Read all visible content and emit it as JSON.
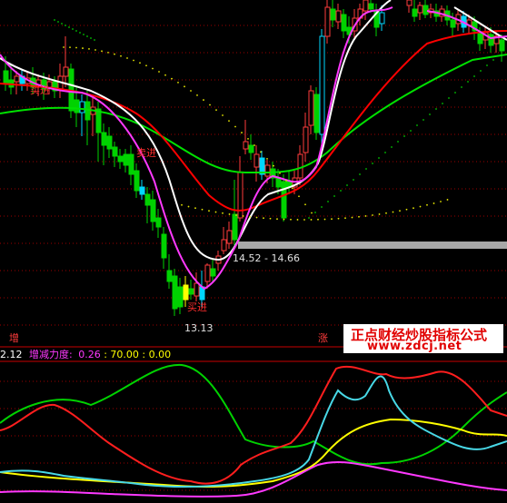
{
  "colors": {
    "bg": "#000000",
    "up": "#ff3c3c",
    "down": "#00d200",
    "flat": "#00d7ff",
    "ma_white": "#ffffff",
    "ma_magenta": "#ff39ff",
    "ma_red": "#ff0000",
    "ma_green": "#00e100",
    "dots_yellow": "#e6e600",
    "dots_green": "#00c800",
    "grid": "#9b0000",
    "divider": "#c80000",
    "signal": "#ffff00",
    "gray_band": "#a8a8a8"
  },
  "main_chart": {
    "signals": [
      {
        "text": "买进",
        "kind": "buy"
      },
      {
        "text": "买进",
        "kind": "buy"
      },
      {
        "text": "卖进",
        "kind": "buy"
      }
    ],
    "band_label": "14.52 - 14.66",
    "low_label": "13.13",
    "corner_left": "增",
    "corner_mid": "涨"
  },
  "sub_header": {
    "value_prefix": "2.12",
    "indicator_name": "增减力度:",
    "v1": "0.26",
    "sep1": " : ",
    "v2": "70.00",
    "sep2": " : ",
    "v3": "0.00"
  },
  "watermark": {
    "title": "正点财经炒股指标公式",
    "url": "www.zdcj.net"
  },
  "chart_data": {
    "type": "line",
    "title": "",
    "note": "candlestick price chart with moving averages and an oscillator sub-panel",
    "price_range_visible": {
      "band_low": 14.52,
      "band_high": 14.66,
      "low": 13.13
    },
    "indicator_values": [
      0.26,
      70.0,
      0.0
    ]
  }
}
